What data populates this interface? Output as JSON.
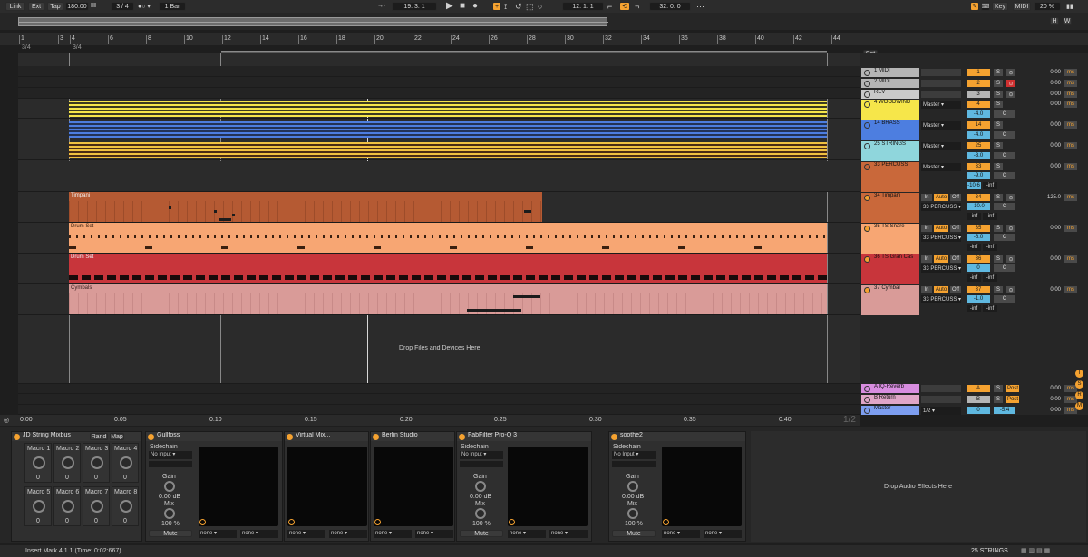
{
  "transport": {
    "link": "Link",
    "ext": "Ext",
    "tap": "Tap",
    "tempo": "180.00",
    "signature": "3 / 4",
    "metro": "1 Bar",
    "position": "19.   3.   1",
    "loop_start": "12.   1.   1",
    "loop_len": "32.   0.   0",
    "key": "Key",
    "midi": "MIDI",
    "cpu": "20 %",
    "h": "H",
    "w": "W"
  },
  "ruler": {
    "ticks": [
      "1",
      "3",
      "4",
      "6",
      "8",
      "10",
      "12",
      "14",
      "16",
      "18",
      "20",
      "22",
      "24",
      "26",
      "28",
      "30",
      "32",
      "34",
      "36",
      "38",
      "40",
      "42",
      "44"
    ],
    "sig_a": "3/4",
    "sig_b": "3/4",
    "loop_a": "1",
    "loop_b": "2",
    "set": "Set"
  },
  "time_ruler": [
    "0:00",
    "0:05",
    "0:10",
    "0:15",
    "0:20",
    "0:25",
    "0:30",
    "0:35",
    "0:40"
  ],
  "arrangement": {
    "drop_hint": "Drop Files and Devices Here",
    "clips": {
      "timpani": "Timpani",
      "drum1": "Drum Set",
      "drum2": "Drum Set",
      "cymbals": "Cymbals"
    },
    "page": "1/2"
  },
  "mixer": {
    "tracks": [
      {
        "name": "1 MIDI",
        "num": "1",
        "vol": "0.00"
      },
      {
        "name": "2 MIDI",
        "num": "2",
        "vol": "0.00"
      },
      {
        "name": "REV",
        "num": "3",
        "vol": "0.00"
      },
      {
        "name": "4 WOODWIND",
        "num": "4",
        "vol": "0.00",
        "out": "Master",
        "gain": "-4.0"
      },
      {
        "name": "14 BRASS",
        "num": "14",
        "vol": "0.00",
        "out": "Master",
        "gain": "-4.0"
      },
      {
        "name": "25 STRINGS",
        "num": "25",
        "vol": "0.00",
        "out": "Master",
        "gain": "-3.0"
      },
      {
        "name": "33 PERCUSS",
        "num": "33",
        "vol": "0.00",
        "out": "Master",
        "gain": "-9.0",
        "peak": "-10.6",
        "peak2": "-inf"
      },
      {
        "name": "34 Timpani",
        "num": "34",
        "vol": "-125.0",
        "out": "33 PERCUSS",
        "gain": "-10.0",
        "peak": "-inf",
        "peak2": "-inf"
      },
      {
        "name": "35 TS Snare",
        "num": "35",
        "vol": "0.00",
        "out": "33 PERCUSS",
        "gain": "-6.0",
        "peak": "-inf",
        "peak2": "-inf"
      },
      {
        "name": "36 TS Gran Cas",
        "num": "36",
        "vol": "0.00",
        "out": "33 PERCUSS",
        "gain": "0",
        "peak": "-inf",
        "peak2": "-inf"
      },
      {
        "name": "37 Cymbal",
        "num": "37",
        "vol": "0.00",
        "out": "33 PERCUSS",
        "gain": "-1.0",
        "peak": "-inf",
        "peak2": "-inf"
      }
    ],
    "returns": [
      {
        "name": "A IQ-Reverb",
        "num": "A",
        "vol": "0.00",
        "post": "Post"
      },
      {
        "name": "B Return",
        "num": "B",
        "vol": "0.00",
        "post": "Post"
      },
      {
        "name": "Master",
        "num": "0",
        "vol": "0.00",
        "gain": "-5.4",
        "out": "1/2"
      }
    ],
    "in": "In",
    "auto": "Auto",
    "off": "Off",
    "c": "C",
    "s": "S",
    "ms": "ms"
  },
  "devices": {
    "rack": {
      "title": "JD String Mixbus",
      "rand": "Rand",
      "map": "Map",
      "macros": [
        "Macro 1",
        "Macro 2",
        "Macro 3",
        "Macro 4",
        "Macro 5",
        "Macro 6",
        "Macro 7",
        "Macro 8"
      ],
      "macro_value": "0"
    },
    "plugins": [
      {
        "title": "Gullfoss",
        "sidechain": "Sidechain",
        "input": "No Input",
        "gain_label": "Gain",
        "gain": "0.00 dB",
        "mix_label": "Mix",
        "mix": "100 %",
        "mute": "Mute",
        "none1": "none",
        "none2": "none"
      },
      {
        "title": "Virtual Mix...",
        "none1": "none",
        "none2": "none"
      },
      {
        "title": "Berlin Studio",
        "none1": "none",
        "none2": "none"
      },
      {
        "title": "FabFilter Pro-Q 3",
        "sidechain": "Sidechain",
        "input": "No Input",
        "gain_label": "Gain",
        "gain": "0.00 dB",
        "mix_label": "Mix",
        "mix": "100 %",
        "mute": "Mute",
        "none1": "none",
        "none2": "none"
      },
      {
        "title": "soothe2",
        "sidechain": "Sidechain",
        "input": "No Input",
        "gain_label": "Gain",
        "gain": "0.00 dB",
        "mix_label": "Mix",
        "mix": "100 %",
        "mute": "Mute",
        "none1": "none",
        "none2": "none"
      }
    ],
    "drop_hint": "Drop Audio Effects Here"
  },
  "status": {
    "message": "Insert Mark 4.1.1 (Time: 0:02:667)",
    "track": "25 STRINGS"
  },
  "colors": {
    "accent": "#f5a230",
    "woodwind": "#f6e64a",
    "brass": "#4d7ee0",
    "strings": "#8fd6dc",
    "percuss": "#c9683a",
    "snare": "#f7a673",
    "grancas": "#c8353b",
    "cymbal": "#d99b98",
    "return_a": "#d88de0",
    "master": "#7d9ef0"
  }
}
